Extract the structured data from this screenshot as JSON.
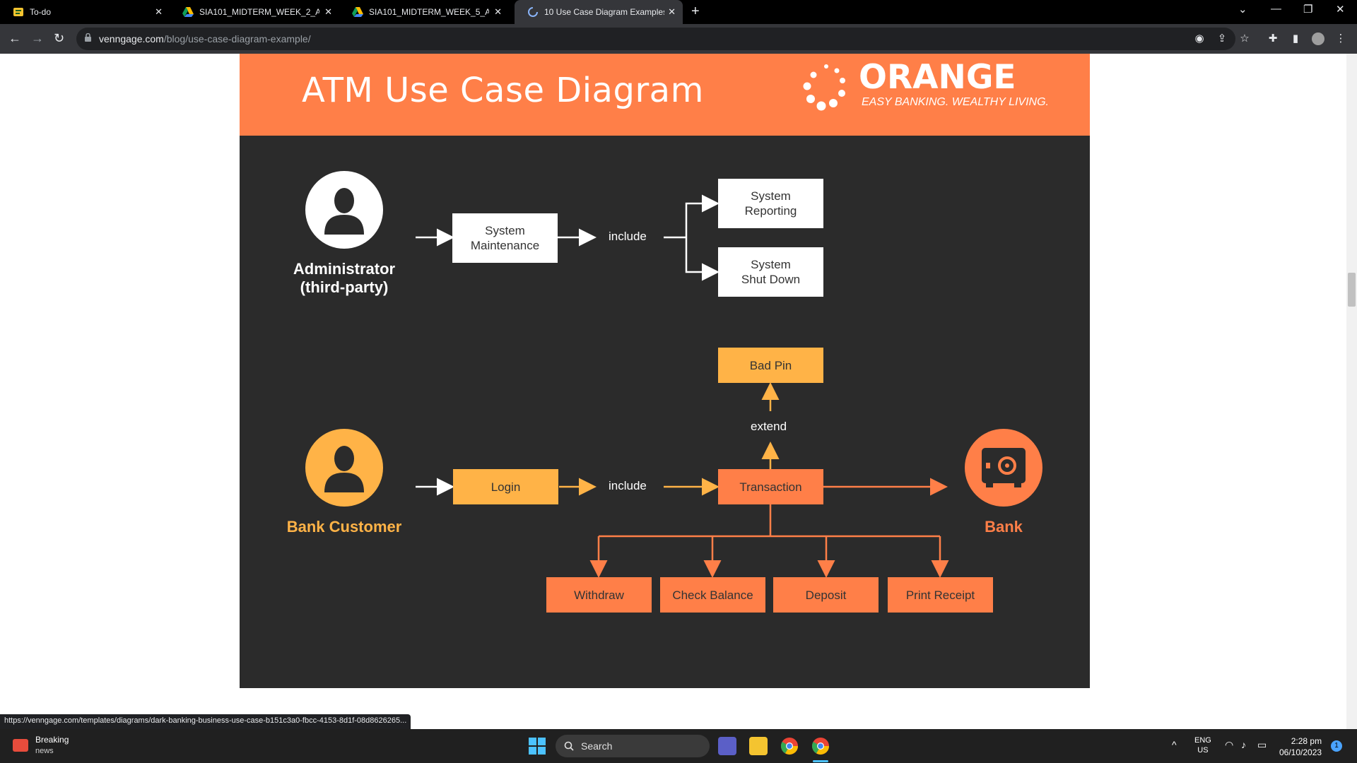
{
  "browser": {
    "tabs": [
      {
        "title": "To-do",
        "active": false
      },
      {
        "title": "SIA101_MIDTERM_WEEK_2_ASSI",
        "active": false
      },
      {
        "title": "SIA101_MIDTERM_WEEK_5_ASSI",
        "active": false
      },
      {
        "title": "10 Use Case Diagram Examples (",
        "active": true
      }
    ],
    "url_domain": "venngage.com",
    "url_path": "/blog/use-case-diagram-example/",
    "status_url": "https://venngage.com/templates/diagrams/dark-banking-business-use-case-b151c3a0-fbcc-4153-8d1f-08d8626265..."
  },
  "diagram": {
    "title": "ATM Use Case Diagram",
    "brand": {
      "name": "ORANGE",
      "tagline": "EASY BANKING. WEALTHY LIVING."
    },
    "actors": {
      "admin": "Administrator\n(third-party)",
      "customer": "Bank Customer",
      "bank": "Bank"
    },
    "use_cases": {
      "system_maintenance": "System\nMaintenance",
      "system_reporting": "System\nReporting",
      "system_shutdown": "System\nShut Down",
      "bad_pin": "Bad Pin",
      "login": "Login",
      "transaction": "Transaction",
      "withdraw": "Withdraw",
      "check_balance": "Check Balance",
      "deposit": "Deposit",
      "print_receipt": "Print Receipt"
    },
    "relations": {
      "include_admin": "include",
      "include_customer": "include",
      "extend": "extend"
    },
    "colors": {
      "background": "#2b2b2b",
      "orange": "#ff7f48",
      "amber": "#ffb347",
      "white": "#ffffff"
    }
  },
  "taskbar": {
    "news_title": "Breaking",
    "news_sub": "news",
    "search_label": "Search",
    "lang": "ENG",
    "region": "US",
    "time": "2:28 pm",
    "date": "06/10/2023",
    "notification_count": "1"
  }
}
